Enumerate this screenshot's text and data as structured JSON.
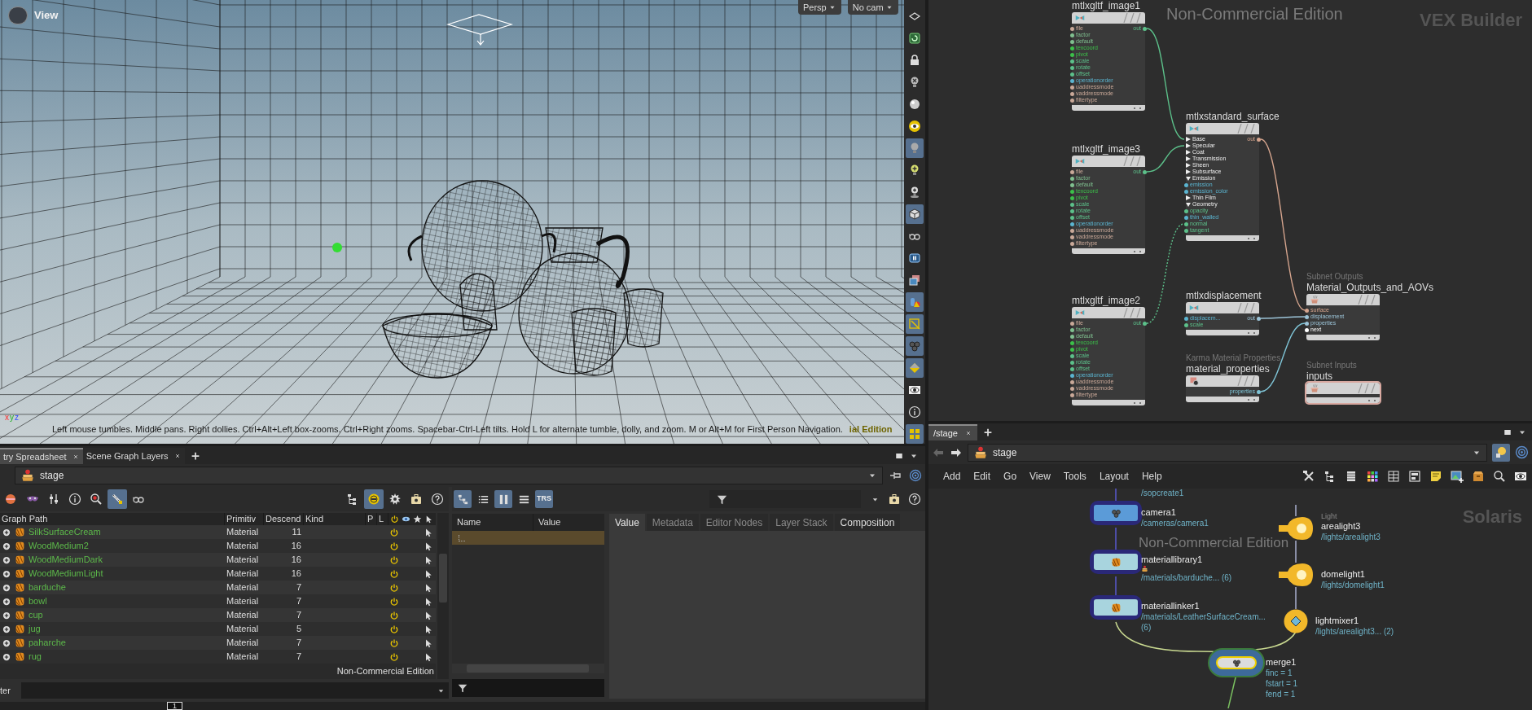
{
  "viewport": {
    "title": "View",
    "view_menus": [
      {
        "label": "Persp"
      },
      {
        "label": "No cam"
      }
    ],
    "axes": [
      "x",
      "y",
      "z"
    ],
    "hint": "Left mouse tumbles. Middle pans. Right dollies. Ctrl+Alt+Left box-zooms. Ctrl+Right zooms. Spacebar-Ctrl-Left tilts. Hold L for alternate tumble, dolly, and zoom. M or Alt+M for First Person Navigation.",
    "edition_note": "ial Edition",
    "toolbar": [
      {
        "kind": "plane",
        "selected": false
      },
      {
        "kind": "spiral",
        "selected": false
      },
      {
        "kind": "lock",
        "selected": false
      },
      {
        "kind": "bulbx",
        "selected": false
      },
      {
        "kind": "sphere",
        "selected": false
      },
      {
        "kind": "eyering",
        "selected": false
      },
      {
        "kind": "bulb",
        "selected": true
      },
      {
        "kind": "bulbplus",
        "selected": false
      },
      {
        "kind": "bulbbase",
        "selected": false
      },
      {
        "kind": "cube",
        "selected": true
      },
      {
        "kind": "glasses",
        "selected": false
      },
      {
        "kind": "pause",
        "selected": false
      },
      {
        "kind": "pictures",
        "selected": false
      },
      {
        "kind": "shapes",
        "selected": true
      },
      {
        "kind": "pencilbox",
        "selected": true
      },
      {
        "kind": "spheres",
        "selected": true
      },
      {
        "kind": "diamond",
        "selected": true
      },
      {
        "kind": "eye",
        "selected": false
      },
      {
        "kind": "info",
        "selected": false
      },
      {
        "kind": "grid",
        "selected": true
      }
    ]
  },
  "vex_network": {
    "context_label": "VEX Builder",
    "edition_watermark": "Non-Commercial Edition",
    "nodes": [
      {
        "kind": "image",
        "title": "mtlxgltf_image1",
        "inputs": [
          {
            "kind": "port",
            "label": "file",
            "color": "#c9a898"
          },
          {
            "kind": "port",
            "label": "factor",
            "color": "#7fbf8f"
          },
          {
            "kind": "port",
            "label": "default",
            "color": "#7fbf8f"
          },
          {
            "kind": "port",
            "label": "texcoord",
            "color": "#3cc04a"
          },
          {
            "kind": "port",
            "label": "pivot",
            "color": "#3cc04a"
          },
          {
            "kind": "port",
            "label": "scale",
            "color": "#5cc08a"
          },
          {
            "kind": "port",
            "label": "rotate",
            "color": "#5cc08a"
          },
          {
            "kind": "port",
            "label": "offset",
            "color": "#5cc08a"
          },
          {
            "kind": "port",
            "label": "operationorder",
            "color": "#5ab4d0"
          },
          {
            "kind": "port",
            "label": "uaddressmode",
            "color": "#c9a898"
          },
          {
            "kind": "port",
            "label": "vaddressmode",
            "color": "#c9a898"
          },
          {
            "kind": "port",
            "label": "filtertype",
            "color": "#c9a898"
          }
        ],
        "outputs": [
          {
            "label": "out",
            "color": "#5cc08a"
          }
        ]
      },
      {
        "kind": "surface",
        "title": "mtlxstandard_surface",
        "inputs": [
          {
            "kind": "group",
            "label": "Base",
            "expanded": false
          },
          {
            "kind": "group",
            "label": "Specular",
            "expanded": false
          },
          {
            "kind": "group",
            "label": "Coat",
            "expanded": false
          },
          {
            "kind": "group",
            "label": "Transmission",
            "expanded": false
          },
          {
            "kind": "group",
            "label": "Sheen",
            "expanded": false
          },
          {
            "kind": "group",
            "label": "Subsurface",
            "expanded": false
          },
          {
            "kind": "group",
            "label": "Emission",
            "expanded": true
          },
          {
            "kind": "port",
            "label": "emission",
            "color": "#5ab4d0"
          },
          {
            "kind": "port",
            "label": "emission_color",
            "color": "#5ab4d0"
          },
          {
            "kind": "group",
            "label": "Thin Film",
            "expanded": false
          },
          {
            "kind": "group",
            "label": "Geometry",
            "expanded": true
          },
          {
            "kind": "port",
            "label": "opacity",
            "color": "#5cc08a"
          },
          {
            "kind": "port",
            "label": "thin_walled",
            "color": "#5ab4d0"
          },
          {
            "kind": "port",
            "label": "normal",
            "color": "#5cc08a"
          },
          {
            "kind": "port",
            "label": "tangent",
            "color": "#5cc08a"
          }
        ],
        "outputs": [
          {
            "label": "out",
            "color": "#d6a58e"
          }
        ]
      },
      {
        "kind": "image",
        "title": "mtlxgltf_image3",
        "inputs": [
          {
            "kind": "port",
            "label": "file",
            "color": "#c9a898"
          },
          {
            "kind": "port",
            "label": "factor",
            "color": "#7fbf8f"
          },
          {
            "kind": "port",
            "label": "default",
            "color": "#7fbf8f"
          },
          {
            "kind": "port",
            "label": "texcoord",
            "color": "#3cc04a"
          },
          {
            "kind": "port",
            "label": "pivot",
            "color": "#3cc04a"
          },
          {
            "kind": "port",
            "label": "scale",
            "color": "#5cc08a"
          },
          {
            "kind": "port",
            "label": "rotate",
            "color": "#5cc08a"
          },
          {
            "kind": "port",
            "label": "offset",
            "color": "#5cc08a"
          },
          {
            "kind": "port",
            "label": "operationorder",
            "color": "#5ab4d0"
          },
          {
            "kind": "port",
            "label": "uaddressmode",
            "color": "#c9a898"
          },
          {
            "kind": "port",
            "label": "vaddressmode",
            "color": "#c9a898"
          },
          {
            "kind": "port",
            "label": "filtertype",
            "color": "#c9a898"
          }
        ],
        "outputs": [
          {
            "label": "out",
            "color": "#5cc08a"
          }
        ]
      },
      {
        "kind": "image",
        "title": "mtlxgltf_image2",
        "inputs": [
          {
            "kind": "port",
            "label": "file",
            "color": "#c9a898"
          },
          {
            "kind": "port",
            "label": "factor",
            "color": "#7fbf8f"
          },
          {
            "kind": "port",
            "label": "default",
            "color": "#7fbf8f"
          },
          {
            "kind": "port",
            "label": "texcoord",
            "color": "#3cc04a"
          },
          {
            "kind": "port",
            "label": "pivot",
            "color": "#3cc04a"
          },
          {
            "kind": "port",
            "label": "scale",
            "color": "#5cc08a"
          },
          {
            "kind": "port",
            "label": "rotate",
            "color": "#5cc08a"
          },
          {
            "kind": "port",
            "label": "offset",
            "color": "#5cc08a"
          },
          {
            "kind": "port",
            "label": "operationorder",
            "color": "#5ab4d0"
          },
          {
            "kind": "port",
            "label": "uaddressmode",
            "color": "#c9a898"
          },
          {
            "kind": "port",
            "label": "vaddressmode",
            "color": "#c9a898"
          },
          {
            "kind": "port",
            "label": "filtertype",
            "color": "#c9a898"
          }
        ],
        "outputs": [
          {
            "label": "out",
            "color": "#5cc08a"
          }
        ]
      },
      {
        "kind": "displacement",
        "title": "mtlxdisplacement",
        "inputs": [
          {
            "kind": "port",
            "label": "displacem...",
            "color": "#5ab4d0"
          },
          {
            "kind": "port",
            "label": "scale",
            "color": "#5cc08a"
          }
        ],
        "outputs": [
          {
            "label": "out",
            "color": "#9cc4d8"
          }
        ]
      },
      {
        "kind": "properties",
        "type_label": "Karma Material Properties",
        "title": "material_properties",
        "outputs": [
          {
            "label": "properties",
            "color": "#7fc4d6"
          }
        ]
      },
      {
        "kind": "subnet_output",
        "type_label": "Subnet Outputs",
        "title": "Material_Outputs_and_AOVs",
        "inputs": [
          {
            "kind": "port",
            "label": "surface",
            "color": "#d6a58e"
          },
          {
            "kind": "port",
            "label": "displacement",
            "color": "#9cc4d8"
          },
          {
            "kind": "port",
            "label": "properties",
            "color": "#9cc4d8"
          },
          {
            "kind": "port",
            "label": "next",
            "color": "#ffffff"
          }
        ]
      },
      {
        "kind": "subnet_input",
        "type_label": "Subnet Inputs",
        "title": "inputs"
      }
    ]
  },
  "scene_pane": {
    "tabs": [
      {
        "label": "try Spreadsheet",
        "selected": true
      },
      {
        "label": "Scene Graph Layers",
        "selected": false
      }
    ],
    "path": "stage",
    "toolbar_left": [
      {
        "kind": "disc",
        "selected": false
      },
      {
        "kind": "mask",
        "selected": false
      },
      {
        "kind": "sliders",
        "selected": false
      },
      {
        "kind": "info",
        "selected": false
      },
      {
        "kind": "zoom",
        "selected": false
      },
      {
        "kind": "link",
        "selected": true
      },
      {
        "kind": "glasses",
        "selected": false
      }
    ],
    "toolbar_right": [
      {
        "kind": "hierarchy",
        "selected": false
      },
      {
        "kind": "target",
        "selected": true
      },
      {
        "kind": "gear",
        "selected": false
      },
      {
        "kind": "case",
        "selected": false
      },
      {
        "kind": "help",
        "selected": false
      }
    ],
    "columns": [
      "Graph Path",
      "Primitiv",
      "Descend",
      "Kind",
      "P",
      "L"
    ],
    "rows": [
      {
        "path": "SilkSurfaceCream",
        "primitive": "Material",
        "descendants": "11"
      },
      {
        "path": "WoodMedium2",
        "primitive": "Material",
        "descendants": "16"
      },
      {
        "path": "WoodMediumDark",
        "primitive": "Material",
        "descendants": "16"
      },
      {
        "path": "WoodMediumLight",
        "primitive": "Material",
        "descendants": "16"
      },
      {
        "path": "barduche",
        "primitive": "Material",
        "descendants": "7"
      },
      {
        "path": "bowl",
        "primitive": "Material",
        "descendants": "7"
      },
      {
        "path": "cup",
        "primitive": "Material",
        "descendants": "7"
      },
      {
        "path": "jug",
        "primitive": "Material",
        "descendants": "5"
      },
      {
        "path": "paharche",
        "primitive": "Material",
        "descendants": "7"
      },
      {
        "path": "rug",
        "primitive": "Material",
        "descendants": "7"
      }
    ],
    "edition_watermark": "Non-Commercial Edition",
    "filter_label": "ter",
    "frame": "1"
  },
  "details_pane": {
    "view_modes": [
      {
        "kind": "tree",
        "selected": true
      },
      {
        "kind": "list",
        "selected": false
      },
      {
        "kind": "columns",
        "selected": true
      },
      {
        "kind": "lines",
        "selected": false
      },
      {
        "kind": "trs",
        "label": "TRS",
        "selected": true
      }
    ],
    "columns": [
      "Name",
      "Value"
    ],
    "tabs": [
      {
        "label": "Value",
        "selected": true
      },
      {
        "label": "Metadata",
        "selected": false
      },
      {
        "label": "Editor Nodes",
        "selected": false
      },
      {
        "label": "Layer Stack",
        "selected": false
      },
      {
        "label": "Composition",
        "selected": false
      }
    ]
  },
  "solaris_network": {
    "tabs": [
      {
        "label": "/stage",
        "selected": true
      }
    ],
    "path": "stage",
    "menu": [
      "Add",
      "Edit",
      "Go",
      "View",
      "Tools",
      "Layout",
      "Help"
    ],
    "context_label": "Solaris",
    "edition_watermark": "Non-Commercial Edition",
    "upstream_path": "/sopcreate1",
    "nodes": [
      {
        "kind": "camera",
        "name": "camera1",
        "paths": [
          "/cameras/camera1"
        ]
      },
      {
        "kind": "material_library",
        "name": "materiallibrary1",
        "paths": [
          "/materials/barduche... (6)"
        ]
      },
      {
        "kind": "material_linker",
        "name": "materiallinker1",
        "paths": [
          "/materials/LeatherSurfaceCream...",
          "(6)"
        ]
      },
      {
        "kind": "light",
        "type_label": "Light",
        "name": "arealight3",
        "paths": [
          "/lights/arealight3"
        ]
      },
      {
        "kind": "light",
        "name": "domelight1",
        "paths": [
          "/lights/domelight1"
        ]
      },
      {
        "kind": "light_mixer",
        "name": "lightmixer1",
        "paths": [
          "/lights/arealight3... (2)"
        ]
      },
      {
        "kind": "merge",
        "name": "merge1",
        "paths": [
          "finc = 1",
          "fstart = 1",
          "fend = 1"
        ]
      }
    ]
  }
}
